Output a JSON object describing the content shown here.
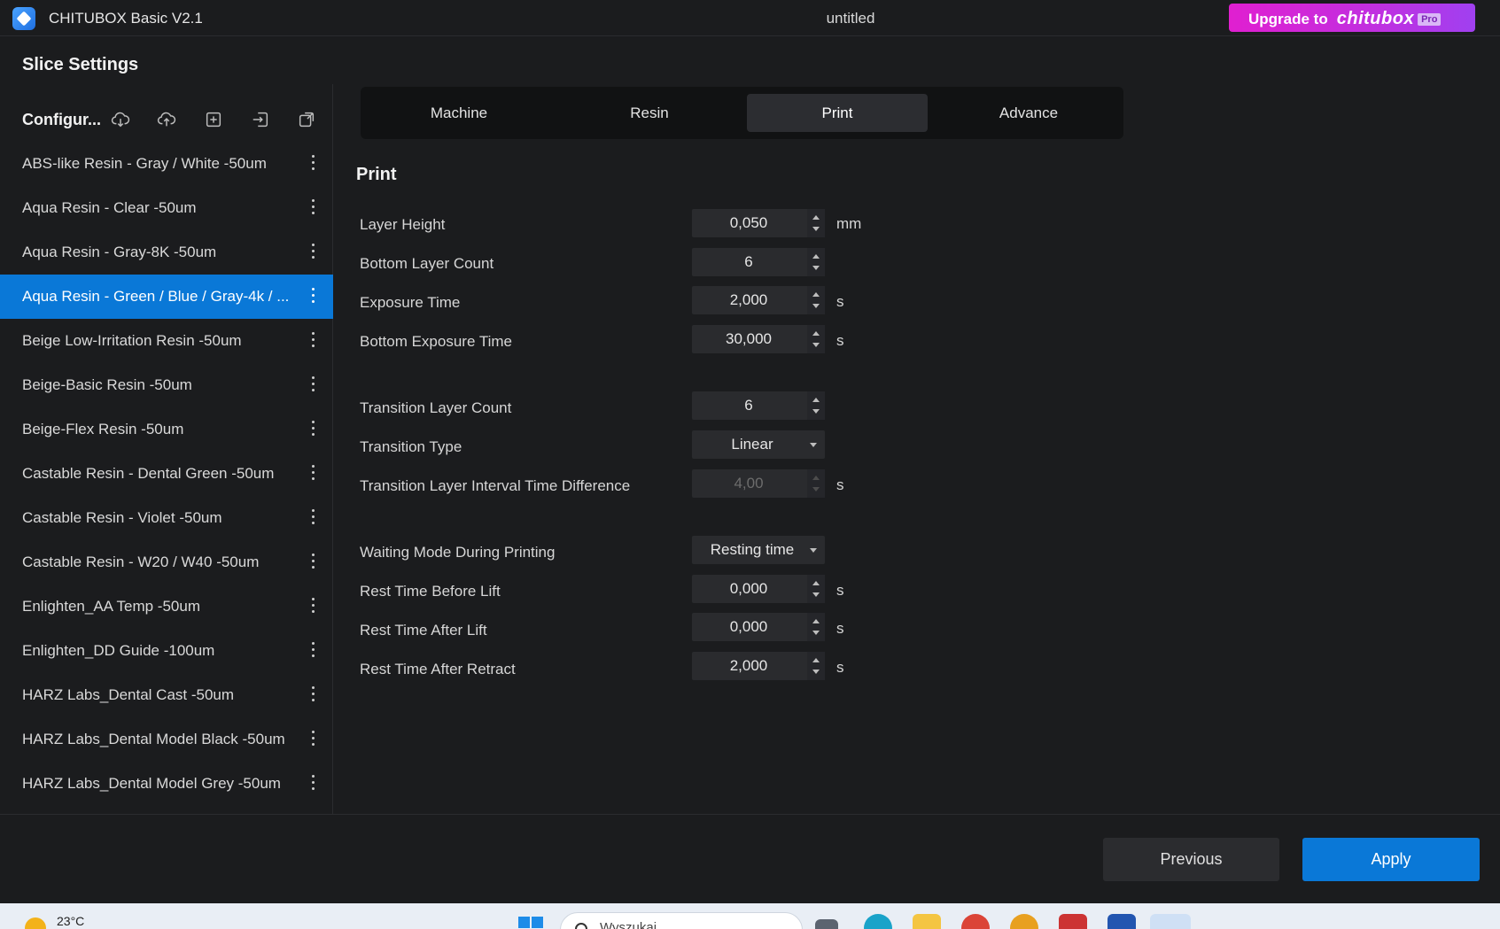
{
  "titlebar": {
    "app_title": "CHITUBOX Basic V2.1",
    "doc_title": "untitled",
    "upgrade_text": "Upgrade to",
    "upgrade_brand": "chitubox",
    "upgrade_badge": "Pro"
  },
  "slice_settings_title": "Slice Settings",
  "sidebar": {
    "config_label": "Configur...",
    "toolbar_icons": [
      "cloud-download-icon",
      "cloud-upload-icon",
      "add-config-icon",
      "import-config-icon",
      "export-config-icon"
    ],
    "items": [
      {
        "label": "ABS-like Resin - Gray / White -50um",
        "active": false
      },
      {
        "label": "Aqua Resin - Clear -50um",
        "active": false
      },
      {
        "label": "Aqua Resin - Gray-8K -50um",
        "active": false
      },
      {
        "label": "Aqua Resin - Green / Blue / Gray-4k / ...",
        "active": true
      },
      {
        "label": "Beige Low-Irritation Resin -50um",
        "active": false
      },
      {
        "label": "Beige-Basic Resin -50um",
        "active": false
      },
      {
        "label": "Beige-Flex Resin -50um",
        "active": false
      },
      {
        "label": "Castable Resin - Dental Green -50um",
        "active": false
      },
      {
        "label": "Castable Resin - Violet -50um",
        "active": false
      },
      {
        "label": "Castable Resin - W20 / W40 -50um",
        "active": false
      },
      {
        "label": "Enlighten_AA Temp -50um",
        "active": false
      },
      {
        "label": "Enlighten_DD Guide -100um",
        "active": false
      },
      {
        "label": "HARZ Labs_Dental Cast -50um",
        "active": false
      },
      {
        "label": "HARZ Labs_Dental Model Black -50um",
        "active": false
      },
      {
        "label": "HARZ Labs_Dental Model Grey -50um",
        "active": false
      }
    ]
  },
  "tabs": [
    {
      "label": "Machine",
      "active": false
    },
    {
      "label": "Resin",
      "active": false
    },
    {
      "label": "Print",
      "active": true
    },
    {
      "label": "Advance",
      "active": false
    }
  ],
  "print": {
    "section_title": "Print",
    "layer_height": {
      "label": "Layer Height",
      "value": "0,050",
      "unit": "mm"
    },
    "bottom_layer_count": {
      "label": "Bottom Layer Count",
      "value": "6",
      "unit": ""
    },
    "exposure_time": {
      "label": "Exposure Time",
      "value": "2,000",
      "unit": "s"
    },
    "bottom_exposure_time": {
      "label": "Bottom Exposure Time",
      "value": "30,000",
      "unit": "s"
    },
    "transition_layer_count": {
      "label": "Transition Layer Count",
      "value": "6",
      "unit": ""
    },
    "transition_type": {
      "label": "Transition Type",
      "value": "Linear"
    },
    "transition_interval": {
      "label": "Transition Layer Interval Time Difference",
      "value": "4,00",
      "unit": "s"
    },
    "waiting_mode": {
      "label": "Waiting Mode During Printing",
      "value": "Resting time"
    },
    "rest_before_lift": {
      "label": "Rest Time Before Lift",
      "value": "0,000",
      "unit": "s"
    },
    "rest_after_lift": {
      "label": "Rest Time After Lift",
      "value": "0,000",
      "unit": "s"
    },
    "rest_after_retract": {
      "label": "Rest Time After Retract",
      "value": "2,000",
      "unit": "s"
    }
  },
  "buttons": {
    "previous": "Previous",
    "apply": "Apply"
  },
  "taskbar": {
    "temperature": "23°C",
    "search_placeholder": "Wyszukaj"
  },
  "colors": {
    "accent": "#0a78d7",
    "background": "#1b1c1e",
    "upgrade_gradient_start": "#e01fd0"
  }
}
